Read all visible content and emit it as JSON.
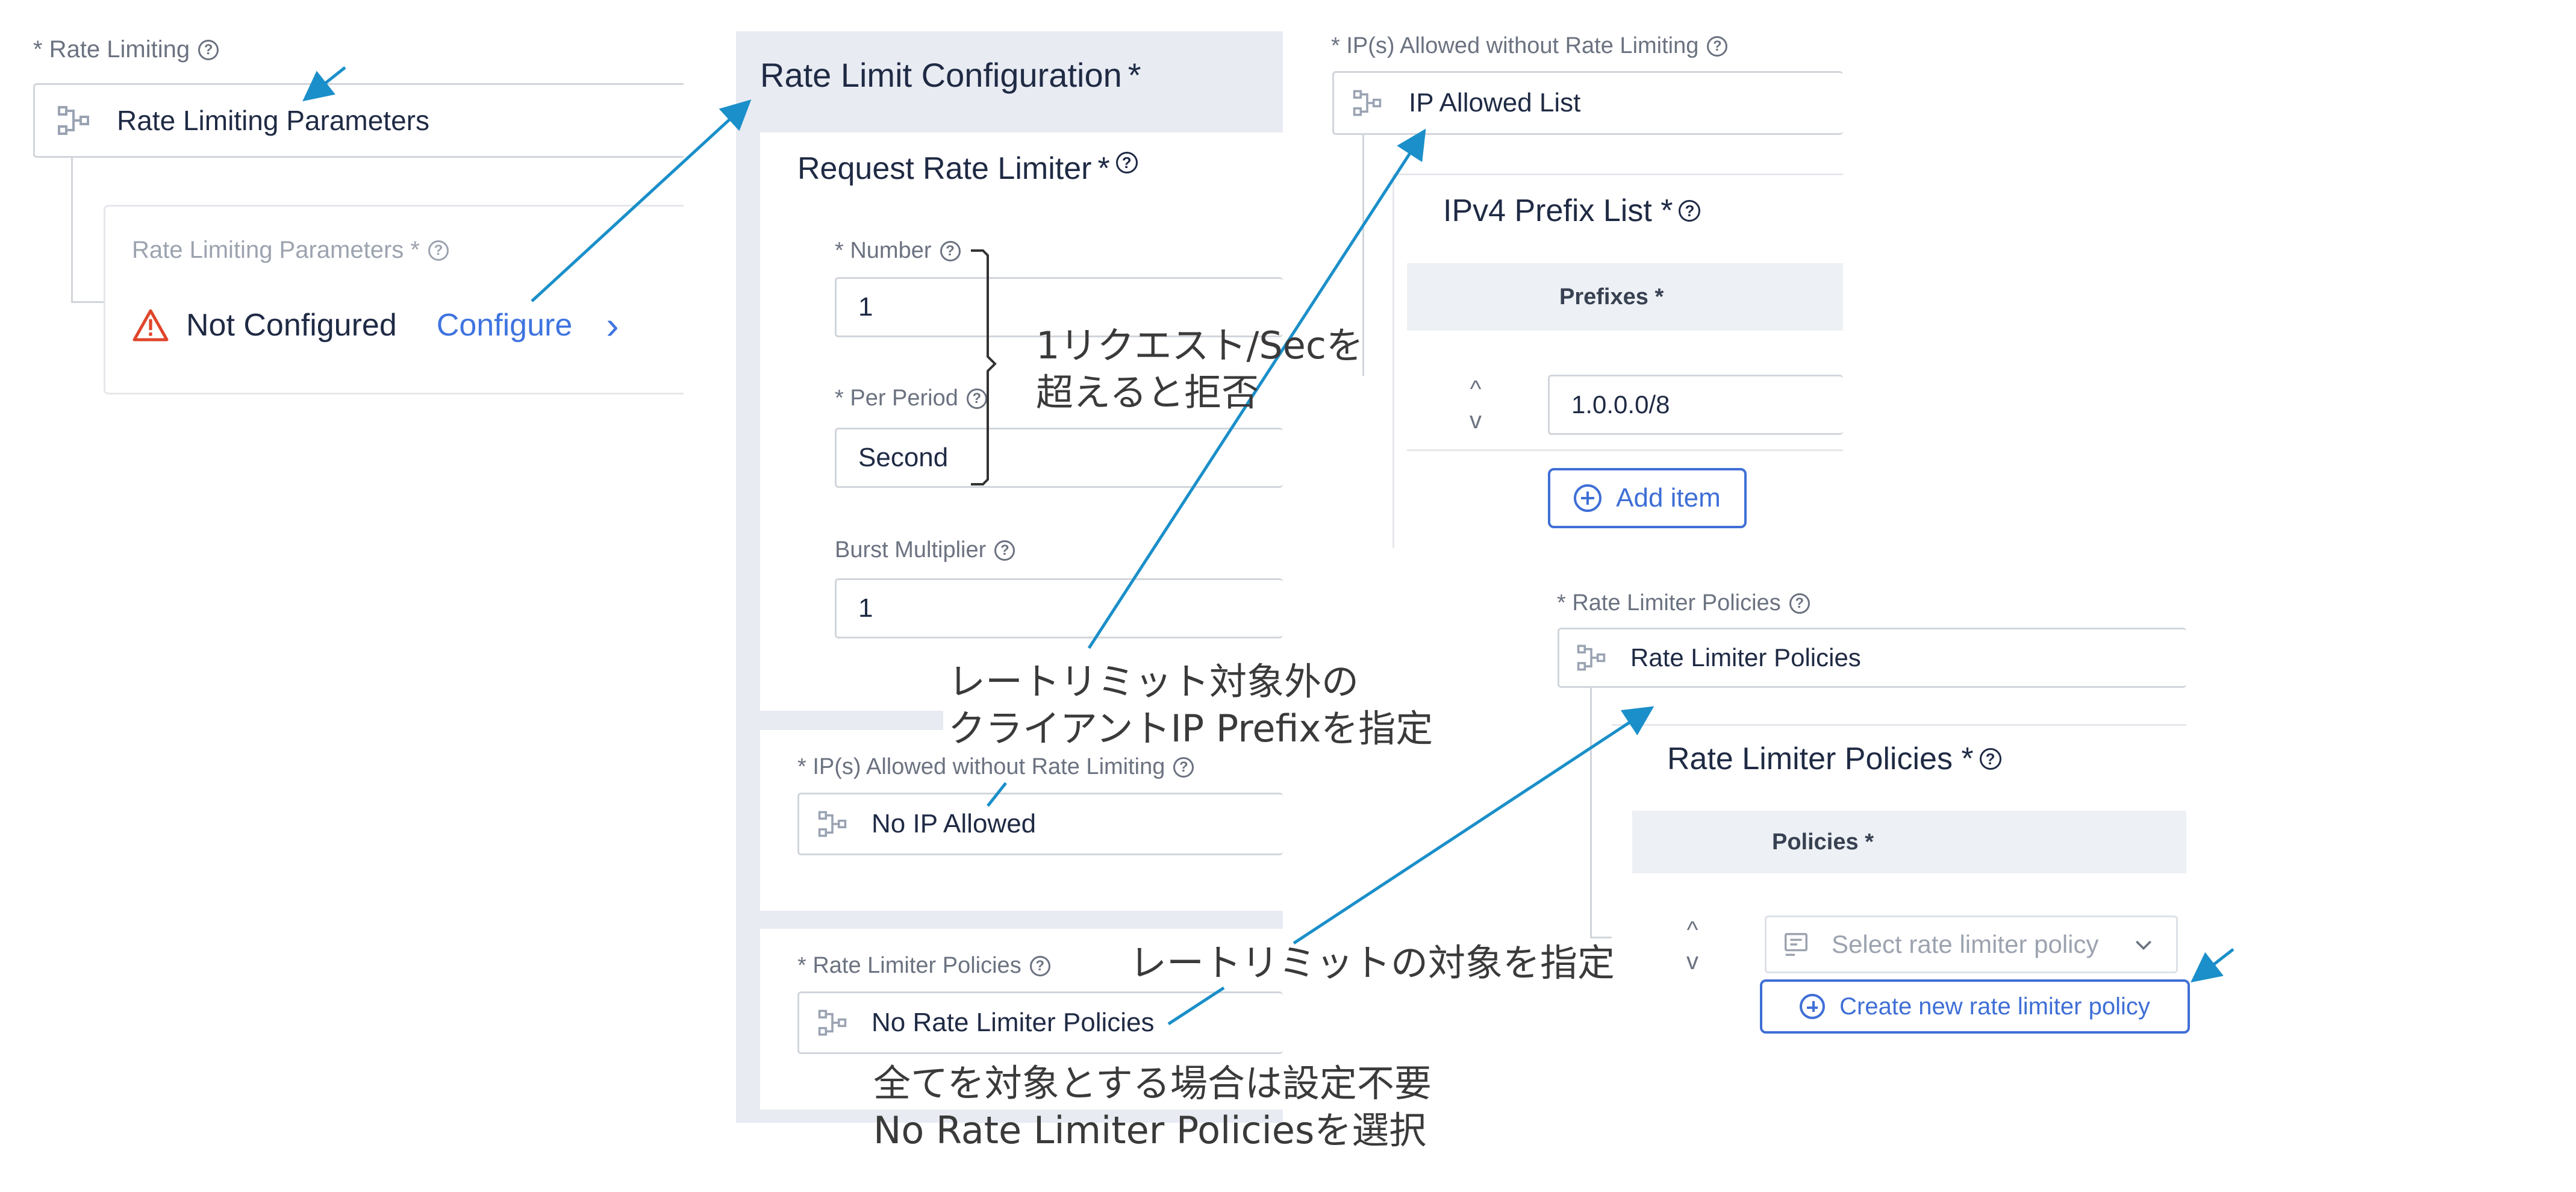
{
  "left": {
    "rate_limiting_label": "* Rate Limiting",
    "rate_limiting_value": "Rate Limiting Parameters",
    "params_label": "Rate Limiting Parameters *",
    "status": "Not Configured",
    "configure": "Configure",
    "chevron": "›"
  },
  "middle": {
    "panel_title": "Rate Limit Configuration",
    "asterisk": "*",
    "request_title": "Request Rate Limiter",
    "number_label": "* Number",
    "number_value": "1",
    "per_period_label": "* Per Period",
    "per_period_value": "Second",
    "burst_label": "Burst Multiplier",
    "burst_value": "1",
    "ip_label": "* IP(s) Allowed without Rate Limiting",
    "ip_value": "No IP Allowed",
    "policies_label": "* Rate Limiter Policies",
    "policies_value": "No Rate Limiter Policies"
  },
  "right_top": {
    "label": "* IP(s) Allowed without Rate Limiting",
    "value": "IP Allowed List",
    "prefix_title": "IPv4 Prefix List *",
    "col_header": "Prefixes *",
    "up": "^",
    "down": "v",
    "prefix_value": "1.0.0.0/8",
    "add_item": "Add item"
  },
  "right_bottom": {
    "label": "* Rate Limiter Policies",
    "value": "Rate Limiter Policies",
    "title": "Rate Limiter Policies *",
    "col_header": "Policies *",
    "up": "^",
    "down": "v",
    "select_placeholder": "Select rate limiter policy",
    "create_button": "Create new rate limiter policy"
  },
  "annotations": {
    "reject_line1": "1リクエスト/Secを",
    "reject_line2": "超えると拒否",
    "ip_line1": "レートリミット対象外の",
    "ip_line2": "クライアントIP Prefixを指定",
    "target": "レートリミットの対象を指定",
    "all_line1": "全てを対象とする場合は設定不要",
    "all_line2": "No Rate Limiter Policiesを選択"
  },
  "colors": {
    "accent": "#3f74e0",
    "arrow": "#1a8fc9",
    "warning": "#e0452b",
    "panel_bg": "#e8ebf2"
  }
}
